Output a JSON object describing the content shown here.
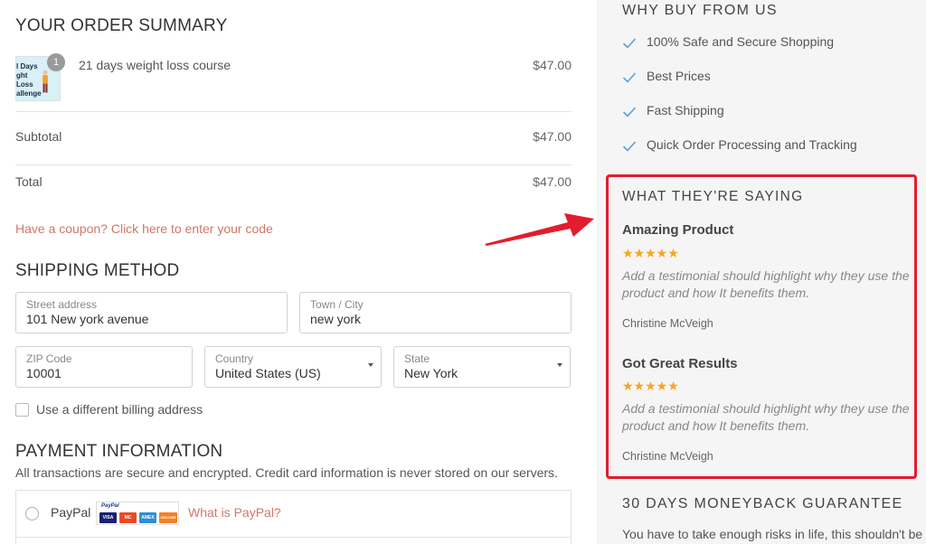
{
  "order_summary": {
    "title": "YOUR ORDER SUMMARY",
    "item": {
      "name": "21 days weight loss course",
      "price": "$47.00",
      "quantity": "1",
      "thumbnail_text": "l Days ght Loss allenge"
    },
    "subtotal_label": "Subtotal",
    "subtotal_value": "$47.00",
    "total_label": "Total",
    "total_value": "$47.00",
    "coupon_text": "Have a coupon? Click here to enter your code"
  },
  "shipping": {
    "title": "SHIPPING METHOD",
    "street": {
      "label": "Street address",
      "value": "101 New york avenue"
    },
    "city": {
      "label": "Town / City",
      "value": "new york"
    },
    "zip": {
      "label": "ZIP Code",
      "value": "10001"
    },
    "country": {
      "label": "Country",
      "value": "United States (US)"
    },
    "state": {
      "label": "State",
      "value": "New York"
    },
    "billing_checkbox_label": "Use a different billing address"
  },
  "payment": {
    "title": "PAYMENT INFORMATION",
    "note": "All transactions are secure and encrypted. Credit card information is never stored on our servers.",
    "paypal_label": "PayPal",
    "paypal_logo_text": "PayPal",
    "card_brands": [
      "VISA",
      "MC",
      "AMEX",
      "DISCOVER"
    ],
    "what_is_paypal": "What is PayPal?"
  },
  "sidebar": {
    "why_title": "WHY BUY FROM US",
    "why_items": [
      "100% Safe and Secure Shopping",
      "Best Prices",
      "Fast Shipping",
      "Quick Order Processing and Tracking"
    ],
    "testimonials_title": "WHAT THEY'RE SAYING",
    "testimonials": [
      {
        "title": "Amazing Product",
        "stars": "★★★★★",
        "rating": 5,
        "body": "Add a testimonial should highlight why they use the product and how It benefits them.",
        "author": "Christine McVeigh"
      },
      {
        "title": "Got Great Results",
        "stars": "★★★★★",
        "rating": 5,
        "body": "Add a testimonial should highlight why they use the product and how It benefits them.",
        "author": "Christine McVeigh"
      }
    ],
    "guarantee_title": "30 DAYS MONEYBACK GUARANTEE",
    "guarantee_text": "You have to take enough risks in life, this shouldn't be"
  },
  "colors": {
    "accent_link": "#d0786a",
    "highlight_border": "#e11d2e",
    "star": "#f5a623",
    "check": "#5aa0d8",
    "sidebar_bg": "#f5f5f5"
  },
  "icons": [
    "checkmark-icon",
    "star-icon",
    "chevron-down-icon",
    "annotation-arrow"
  ]
}
